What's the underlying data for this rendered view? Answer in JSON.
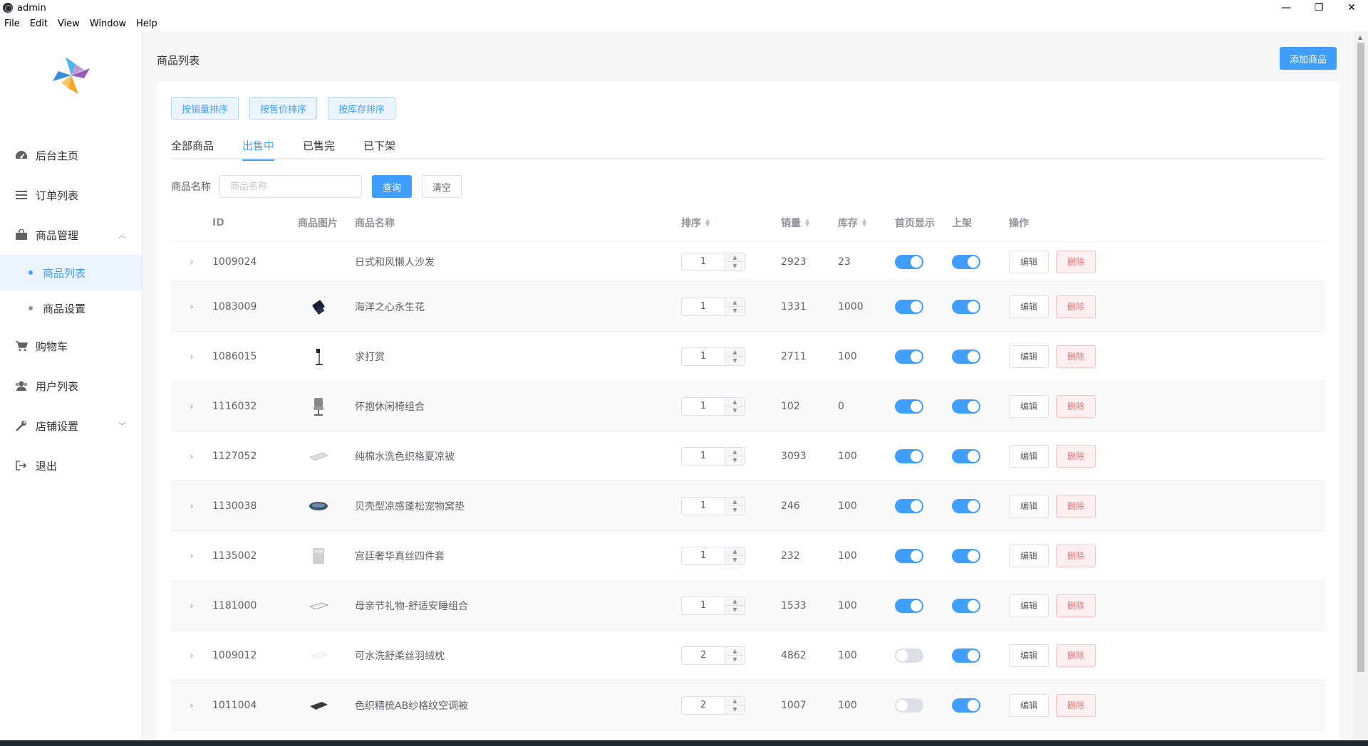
{
  "window": {
    "title": "admin",
    "controls": [
      "—",
      "❐",
      "✕"
    ]
  },
  "menubar": [
    "File",
    "Edit",
    "View",
    "Window",
    "Help"
  ],
  "sidebar": {
    "items": [
      {
        "label": "后台主页",
        "icon": "dashboard-icon"
      },
      {
        "label": "订单列表",
        "icon": "list-icon"
      },
      {
        "label": "商品管理",
        "icon": "bag-icon",
        "expanded": true,
        "children": [
          {
            "label": "商品列表",
            "active": true
          },
          {
            "label": "商品设置",
            "active": false
          }
        ]
      },
      {
        "label": "购物车",
        "icon": "cart-icon"
      },
      {
        "label": "用户列表",
        "icon": "users-icon"
      },
      {
        "label": "店铺设置",
        "icon": "wrench-icon",
        "expanded": false
      },
      {
        "label": "退出",
        "icon": "logout-icon"
      }
    ]
  },
  "header": {
    "title": "商品列表",
    "add_label": "添加商品"
  },
  "sort_buttons": [
    "按销量排序",
    "按售价排序",
    "按库存排序"
  ],
  "tabs": [
    {
      "label": "全部商品",
      "active": false
    },
    {
      "label": "出售中",
      "active": true
    },
    {
      "label": "已售完",
      "active": false
    },
    {
      "label": "已下架",
      "active": false
    }
  ],
  "filter": {
    "label": "商品名称",
    "placeholder": "商品名称",
    "search_label": "查询",
    "clear_label": "清空"
  },
  "table": {
    "columns": {
      "id": "ID",
      "image": "商品图片",
      "name": "商品名称",
      "sort": "排序",
      "sales": "销量",
      "stock": "库存",
      "home": "首页显示",
      "shelf": "上架",
      "ops": "操作"
    },
    "edit_label": "编辑",
    "delete_label": "删除",
    "rows": [
      {
        "id": "1009024",
        "image": "none",
        "name": "日式和风懒人沙发",
        "sort": "1",
        "sales": "2923",
        "stock": "23",
        "home": true,
        "shelf": true
      },
      {
        "id": "1083009",
        "image": "gift-box",
        "name": "海洋之心永生花",
        "sort": "1",
        "sales": "1331",
        "stock": "1000",
        "home": true,
        "shelf": true
      },
      {
        "id": "1086015",
        "image": "lamp",
        "name": "求打赏",
        "sort": "1",
        "sales": "2711",
        "stock": "100",
        "home": true,
        "shelf": true
      },
      {
        "id": "1116032",
        "image": "chair",
        "name": "怀抱休闲椅组合",
        "sort": "1",
        "sales": "102",
        "stock": "0",
        "home": true,
        "shelf": true
      },
      {
        "id": "1127052",
        "image": "quilt",
        "name": "纯棉水洗色织格夏凉被",
        "sort": "1",
        "sales": "3093",
        "stock": "100",
        "home": true,
        "shelf": true
      },
      {
        "id": "1130038",
        "image": "pet-bed",
        "name": "贝壳型凉感蓬松宠物窝垫",
        "sort": "1",
        "sales": "246",
        "stock": "100",
        "home": true,
        "shelf": true
      },
      {
        "id": "1135002",
        "image": "bedding",
        "name": "宫廷奢华真丝四件套",
        "sort": "1",
        "sales": "232",
        "stock": "100",
        "home": true,
        "shelf": true
      },
      {
        "id": "1181000",
        "image": "mattress",
        "name": "母亲节礼物-舒适安睡组合",
        "sort": "1",
        "sales": "1533",
        "stock": "100",
        "home": true,
        "shelf": true
      },
      {
        "id": "1009012",
        "image": "pillow",
        "name": "可水洗舒柔丝羽绒枕",
        "sort": "2",
        "sales": "4862",
        "stock": "100",
        "home": false,
        "shelf": true
      },
      {
        "id": "1011004",
        "image": "dark-quilt",
        "name": "色织精梳AB纱格纹空调被",
        "sort": "2",
        "sales": "1007",
        "stock": "100",
        "home": false,
        "shelf": true
      }
    ]
  },
  "colors": {
    "primary": "#409eff",
    "danger": "#f56c6c"
  }
}
